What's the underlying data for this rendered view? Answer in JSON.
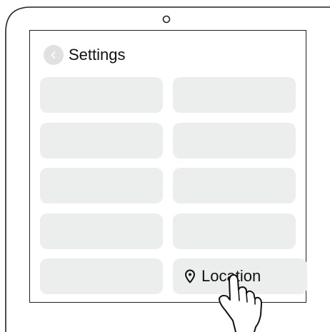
{
  "header": {
    "back_icon": "chevron-left-icon",
    "title": "Settings"
  },
  "tiles": [
    {
      "label": ""
    },
    {
      "label": ""
    },
    {
      "label": ""
    },
    {
      "label": ""
    },
    {
      "label": ""
    },
    {
      "label": ""
    },
    {
      "label": ""
    },
    {
      "label": ""
    },
    {
      "label": ""
    },
    {
      "label": "Location",
      "icon": "location-pin-icon"
    }
  ],
  "colors": {
    "tile": "#eceeee",
    "back_button": "#e1e1e1",
    "outline": "#222222"
  },
  "pointer_icon": "pointing-hand-icon"
}
